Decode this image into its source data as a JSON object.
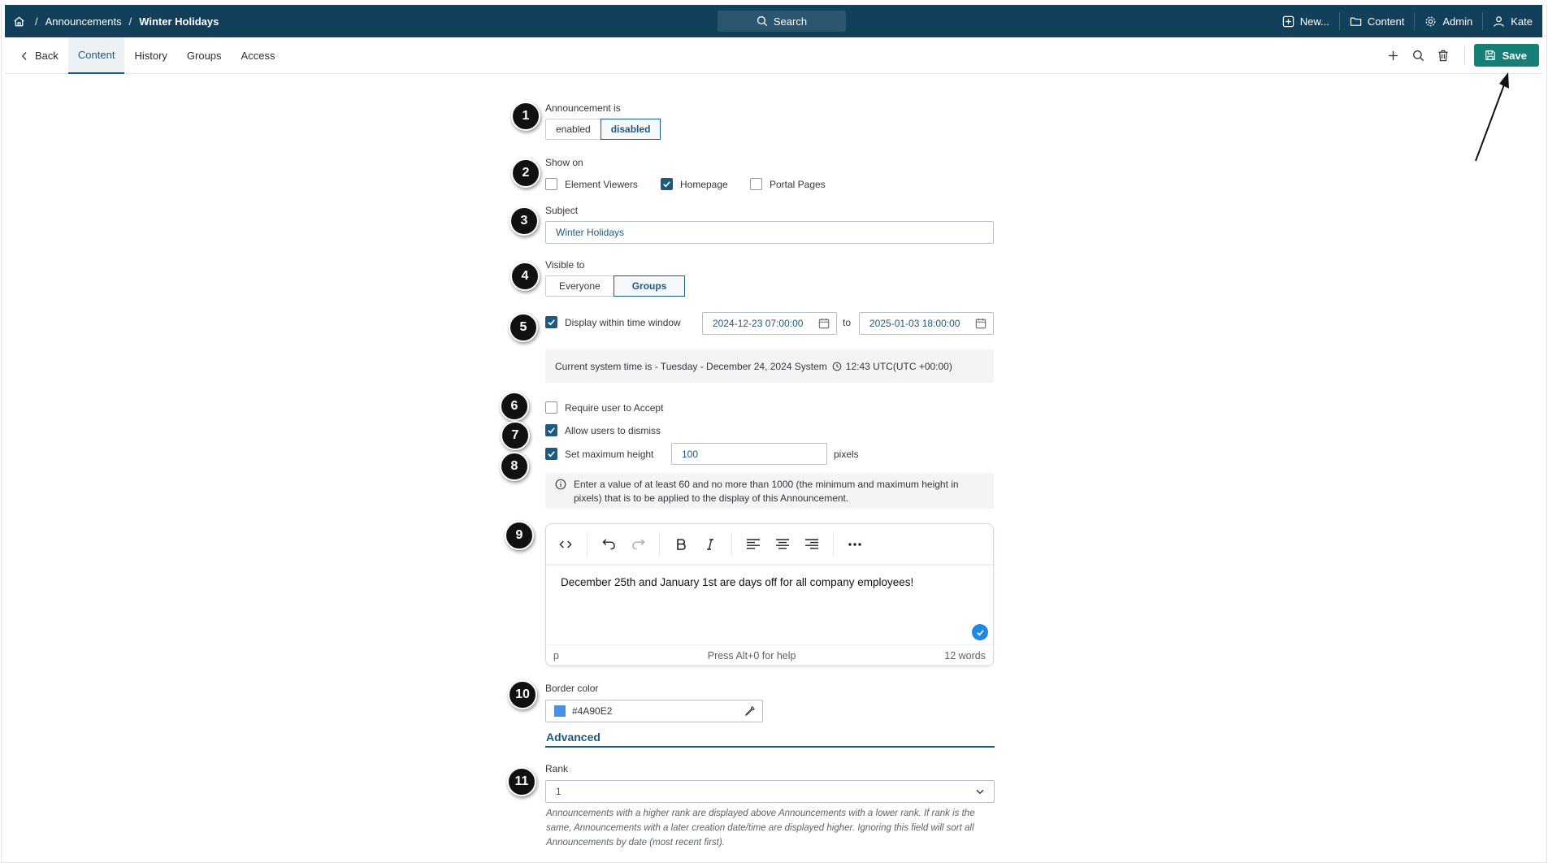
{
  "header": {
    "breadcrumb": [
      "Announcements",
      "Winter Holidays"
    ],
    "search_label": "Search",
    "nav": {
      "new": "New...",
      "content": "Content",
      "admin": "Admin",
      "user": "Kate"
    }
  },
  "tabs": {
    "back": "Back",
    "items": [
      "Content",
      "History",
      "Groups",
      "Access"
    ],
    "active": "Content"
  },
  "toolbar": {
    "save_label": "Save"
  },
  "form": {
    "status": {
      "label": "Announcement is",
      "options": [
        "enabled",
        "disabled"
      ],
      "selected": "disabled"
    },
    "show_on": {
      "label": "Show on",
      "options": [
        {
          "label": "Element Viewers",
          "checked": false
        },
        {
          "label": "Homepage",
          "checked": true
        },
        {
          "label": "Portal Pages",
          "checked": false
        }
      ]
    },
    "subject": {
      "label": "Subject",
      "value": "Winter Holidays"
    },
    "visible_to": {
      "label": "Visible to",
      "options": [
        "Everyone",
        "Groups"
      ],
      "selected": "Groups"
    },
    "time_window": {
      "label": "Display within time window",
      "checked": true,
      "from": "2024-12-23 07:00:00",
      "to_label": "to",
      "to": "2025-01-03 18:00:00"
    },
    "system_time": {
      "prefix": "Current system time is - Tuesday - December 24, 2024 System",
      "time": "12:43 UTC(UTC +00:00)"
    },
    "require_accept": {
      "label": "Require user to Accept",
      "checked": false
    },
    "allow_dismiss": {
      "label": "Allow users to dismiss",
      "checked": true
    },
    "max_height": {
      "label": "Set maximum height",
      "checked": true,
      "value": "100",
      "unit": "pixels"
    },
    "height_info": "Enter a value of at least 60 and no more than 1000 (the minimum and maximum height in pixels) that is to be applied to the display of this Announcement.",
    "editor": {
      "body": "December 25th and January 1st are days off for all company employees!",
      "path": "p",
      "help": "Press Alt+0 for help",
      "words": "12 words"
    },
    "border_color": {
      "label": "Border color",
      "value": "#4A90E2"
    },
    "advanced_label": "Advanced",
    "rank": {
      "label": "Rank",
      "value": "1",
      "hint": "Announcements with a higher rank are displayed above Announcements with a lower rank. If rank is the same, Announcements with a later creation date/time are displayed higher. Ignoring this field will sort all Announcements by date (most recent first)."
    }
  },
  "callouts": [
    "1",
    "2",
    "3",
    "4",
    "5",
    "6",
    "7",
    "8",
    "9",
    "10",
    "11"
  ],
  "colors": {
    "nav_bg": "#123f5a",
    "accent": "#1d5a80",
    "save_bg": "#177f75",
    "swatch": "#4A90E2"
  }
}
